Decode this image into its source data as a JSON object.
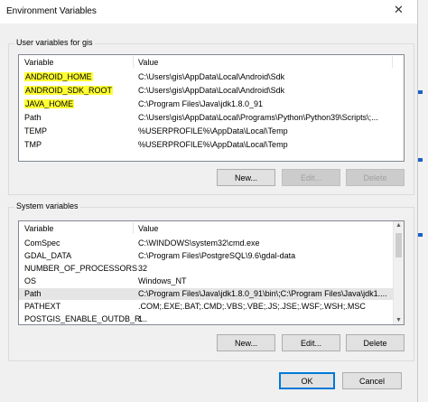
{
  "window": {
    "title": "Environment Variables",
    "close_glyph": "✕"
  },
  "user_section": {
    "label": "User variables for gis",
    "columns": [
      "Variable",
      "Value"
    ],
    "rows": [
      {
        "variable": "ANDROID_HOME",
        "value": "C:\\Users\\gis\\AppData\\Local\\Android\\Sdk",
        "highlight": true
      },
      {
        "variable": "ANDROID_SDK_ROOT",
        "value": "C:\\Users\\gis\\AppData\\Local\\Android\\Sdk",
        "highlight": true
      },
      {
        "variable": "JAVA_HOME",
        "value": "C:\\Program Files\\Java\\jdk1.8.0_91",
        "highlight": true
      },
      {
        "variable": "Path",
        "value": "C:\\Users\\gis\\AppData\\Local\\Programs\\Python\\Python39\\Scripts\\;...",
        "highlight": false
      },
      {
        "variable": "TEMP",
        "value": "%USERPROFILE%\\AppData\\Local\\Temp",
        "highlight": false
      },
      {
        "variable": "TMP",
        "value": "%USERPROFILE%\\AppData\\Local\\Temp",
        "highlight": false
      }
    ],
    "buttons": {
      "new": "New...",
      "edit": "Edit...",
      "delete": "Delete"
    }
  },
  "system_section": {
    "label": "System variables",
    "columns": [
      "Variable",
      "Value"
    ],
    "rows": [
      {
        "variable": "ComSpec",
        "value": "C:\\WINDOWS\\system32\\cmd.exe"
      },
      {
        "variable": "GDAL_DATA",
        "value": "C:\\Program Files\\PostgreSQL\\9.6\\gdal-data"
      },
      {
        "variable": "NUMBER_OF_PROCESSORS",
        "value": "32"
      },
      {
        "variable": "OS",
        "value": "Windows_NT"
      },
      {
        "variable": "Path",
        "value": "C:\\Program Files\\Java\\jdk1.8.0_91\\bin\\;C:\\Program Files\\Java\\jdk1....",
        "selected": true
      },
      {
        "variable": "PATHEXT",
        "value": ".COM;.EXE;.BAT;.CMD;.VBS;.VBE;.JS;.JSE;.WSF;.WSH;.MSC"
      },
      {
        "variable": "POSTGIS_ENABLE_OUTDB_R...",
        "value": "1"
      }
    ],
    "buttons": {
      "new": "New...",
      "edit": "Edit...",
      "delete": "Delete"
    }
  },
  "footer": {
    "ok": "OK",
    "cancel": "Cancel"
  },
  "colors": {
    "highlight": "#ffff33",
    "selection": "#e5e5e5",
    "accent": "#0078d7"
  }
}
